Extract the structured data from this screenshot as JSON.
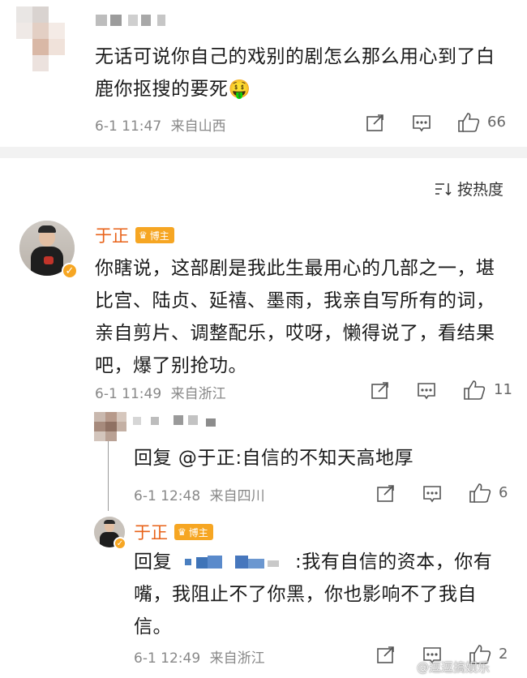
{
  "comment1": {
    "text": "无话可说你自己的戏别的剧怎么那么用心到了白鹿你抠搜的要死",
    "emoji": "🤑",
    "time": "6-1 11:47",
    "location": "来自山西",
    "likes": "66"
  },
  "sort": {
    "label": "按热度",
    "icon": "sort-icon"
  },
  "comment2": {
    "author": "于正",
    "badge": "博主",
    "text": "你瞎说，这部剧是我此生最用心的几部之一，堪比宫、陆贞、延禧、墨雨，我亲自写所有的词，亲自剪片、调整配乐，哎呀，懒得说了，看结果吧，爆了别抢功。",
    "time": "6-1 11:49",
    "location": "来自浙江",
    "likes": "11"
  },
  "reply1": {
    "prefix": "回复 ",
    "mention": "@于正",
    "text": ":自信的不知天高地厚",
    "time": "6-1 12:48",
    "location": "来自四川",
    "likes": "6"
  },
  "reply2": {
    "author": "于正",
    "badge": "博主",
    "prefix": "回复",
    "text": ":我有自信的资本，你有嘴，我阻止不了你黑，你也影响不了我自信。",
    "time": "6-1 12:49",
    "location": "来自浙江",
    "likes": "2"
  },
  "watermark": "@逗逗搞娱乐",
  "colors": {
    "accent": "#e8631a",
    "badge": "#f6a623",
    "meta": "#888888"
  }
}
